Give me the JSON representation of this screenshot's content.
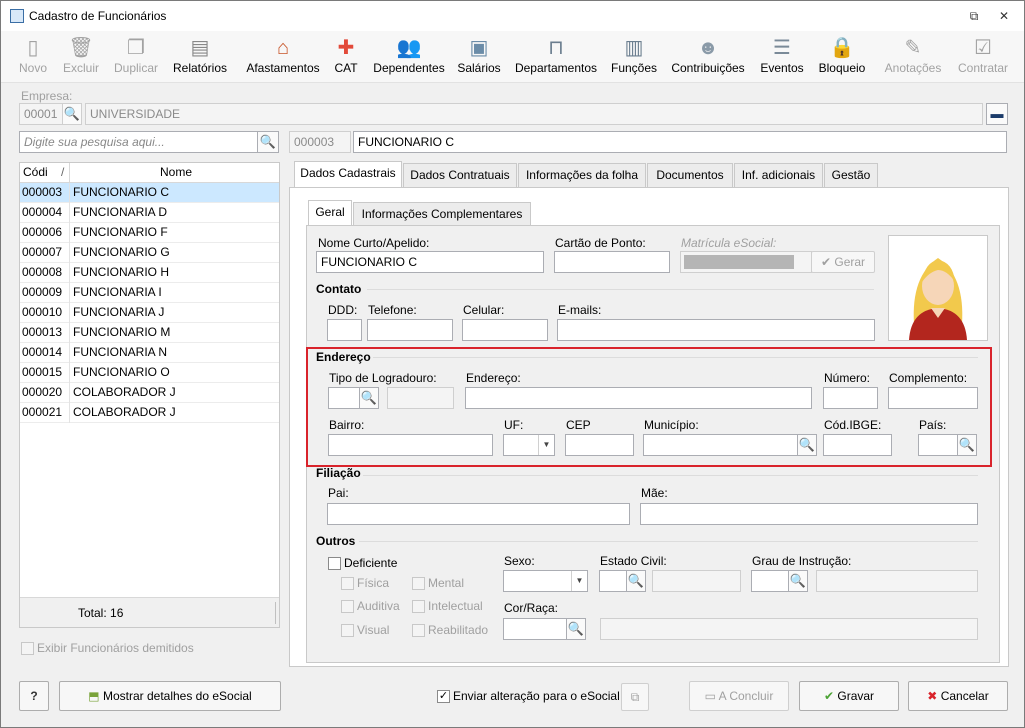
{
  "window": {
    "title": "Cadastro de Funcionários",
    "minimize_icon": "restore-icon",
    "close_icon": "close-icon"
  },
  "toolbar": [
    {
      "label": "Novo",
      "icon": "new-icon",
      "enabled": false
    },
    {
      "label": "Excluir",
      "icon": "trash-icon",
      "enabled": false
    },
    {
      "label": "Duplicar",
      "icon": "duplicate-icon",
      "enabled": false
    },
    {
      "label": "Relatórios",
      "icon": "report-icon",
      "enabled": true
    },
    {
      "label": "Afastamentos",
      "icon": "house-icon",
      "enabled": true
    },
    {
      "label": "CAT",
      "icon": "medical-cross-icon",
      "enabled": true
    },
    {
      "label": "Dependentes",
      "icon": "people-icon",
      "enabled": true
    },
    {
      "label": "Salários",
      "icon": "money-icon",
      "enabled": true
    },
    {
      "label": "Departamentos",
      "icon": "desk-icon",
      "enabled": true
    },
    {
      "label": "Funções",
      "icon": "badge-icon",
      "enabled": true
    },
    {
      "label": "Contribuições",
      "icon": "heads-icon",
      "enabled": true
    },
    {
      "label": "Eventos",
      "icon": "list-icon",
      "enabled": true
    },
    {
      "label": "Bloqueio",
      "icon": "lock-icon",
      "enabled": true
    },
    {
      "label": "Anotações",
      "icon": "note-icon",
      "enabled": false
    },
    {
      "label": "Contratar",
      "icon": "hire-icon",
      "enabled": false
    }
  ],
  "empresa": {
    "label": "Empresa:",
    "code": "00001",
    "name": "UNIVERSIDADE"
  },
  "search": {
    "placeholder": "Digite sua pesquisa aqui..."
  },
  "current": {
    "code": "000003",
    "name": "FUNCIONARIO C"
  },
  "grid": {
    "headers": [
      "Códi",
      "Nome"
    ],
    "sort_indicator": "/",
    "rows": [
      {
        "code": "000003",
        "name": "FUNCIONARIO C"
      },
      {
        "code": "000004",
        "name": "FUNCIONARIA D"
      },
      {
        "code": "000006",
        "name": "FUNCIONARIO F"
      },
      {
        "code": "000007",
        "name": "FUNCIONARIO G"
      },
      {
        "code": "000008",
        "name": "FUNCIONARIO H"
      },
      {
        "code": "000009",
        "name": "FUNCIONARIA I"
      },
      {
        "code": "000010",
        "name": "FUNCIONARIA J"
      },
      {
        "code": "000013",
        "name": "FUNCIONARIO M"
      },
      {
        "code": "000014",
        "name": "FUNCIONARIA N"
      },
      {
        "code": "000015",
        "name": "FUNCIONARIO O"
      },
      {
        "code": "000020",
        "name": "COLABORADOR J"
      },
      {
        "code": "000021",
        "name": "COLABORADOR J"
      }
    ],
    "total": "Total: 16"
  },
  "show_dismissed": "Exibir Funcionários demitidos",
  "tabs": [
    "Dados Cadastrais",
    "Dados Contratuais",
    "Informações da folha",
    "Documentos",
    "Inf. adicionais",
    "Gestão"
  ],
  "subtabs": [
    "Geral",
    "Informações Complementares"
  ],
  "form": {
    "nome_curto_label": "Nome Curto/Apelido:",
    "nome_curto_value": "FUNCIONARIO C",
    "cartao_label": "Cartão de Ponto:",
    "matricula_label": "Matrícula eSocial:",
    "gerar": "Gerar",
    "contato": "Contato",
    "ddd": "DDD:",
    "telefone": "Telefone:",
    "celular": "Celular:",
    "emails": "E-mails:",
    "endereco_group": "Endereço",
    "tipo_logradouro": "Tipo de Logradouro:",
    "endereco": "Endereço:",
    "numero": "Número:",
    "complemento": "Complemento:",
    "bairro": "Bairro:",
    "uf": "UF:",
    "cep": "CEP",
    "municipio": "Município:",
    "cod_ibge": "Cód.IBGE:",
    "pais": "País:",
    "filiacao": "Filiação",
    "pai": "Pai:",
    "mae": "Mãe:",
    "outros": "Outros",
    "deficiente": "Deficiente",
    "fisica": "Física",
    "mental": "Mental",
    "auditiva": "Auditiva",
    "intelectual": "Intelectual",
    "visual": "Visual",
    "reabilitado": "Reabilitado",
    "sexo": "Sexo:",
    "estado_civil": "Estado Civil:",
    "grau_instrucao": "Grau de Instrução:",
    "cor_raca": "Cor/Raça:"
  },
  "footer": {
    "help": "?",
    "esocial_details": "Mostrar detalhes do eSocial",
    "enviar": "Enviar alteração para o eSocial",
    "concluir": "A Concluir",
    "gravar": "Gravar",
    "cancelar": "Cancelar"
  },
  "colors": {
    "highlight_border": "#d9232b",
    "selection": "#cce8ff",
    "avatar_hair": "#f2c94c",
    "avatar_shirt": "#b3261e"
  }
}
